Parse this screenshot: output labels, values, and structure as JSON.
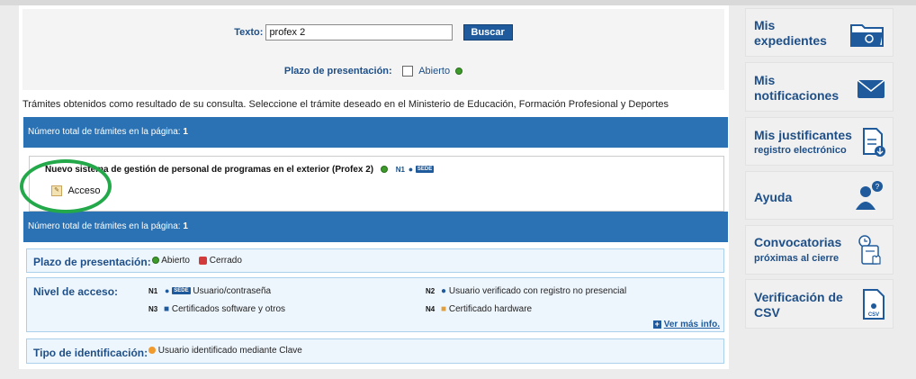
{
  "search": {
    "texto_label": "Texto:",
    "texto_value": "profex 2",
    "buscar_label": "Buscar",
    "plazo_label": "Plazo de presentación:",
    "abierto_label": "Abierto"
  },
  "results": {
    "info": "Trámites obtenidos como resultado de su consulta. Seleccione el trámite deseado en el Ministerio de Educación, Formación Profesional y Deportes",
    "total_label": "Número total de trámites en la página:",
    "total_count": "1",
    "item_title": "Nuevo sistema de gestión de personal de programas en el exterior (Profex 2)",
    "item_level": "N1",
    "sede": "SEDE",
    "acceso_label": "Acceso"
  },
  "legend": {
    "plazo_title": "Plazo de presentación:",
    "abierto": "Abierto",
    "cerrado": "Cerrado",
    "nivel_title": "Nivel de acceso:",
    "n1_code": "N1",
    "n1_text": "Usuario/contraseña",
    "n2_code": "N2",
    "n2_text": "Usuario verificado con registro no presencial",
    "n3_code": "N3",
    "n3_text": "Certificados software y otros",
    "n4_code": "N4",
    "n4_text": "Certificado hardware",
    "ver_mas": "Ver más info.",
    "tipo_title": "Tipo de identificación:",
    "tipo_text": "Usuario identificado mediante Clave"
  },
  "sidebar": {
    "expedientes": [
      "Mis",
      "expedientes"
    ],
    "notificaciones": [
      "Mis",
      "notificaciones"
    ],
    "justificantes_title": "Mis justificantes",
    "justificantes_sub": "registro electrónico",
    "ayuda": "Ayuda",
    "convocatorias_title": "Convocatorias",
    "convocatorias_sub": "próximas al cierre",
    "verificacion": [
      "Verificación de",
      "CSV"
    ],
    "csv_badge": "CSV"
  },
  "colors": {
    "accent_blue": "#2a72b4",
    "link_blue": "#1e4f88",
    "highlight_circle": "#23a84a"
  }
}
